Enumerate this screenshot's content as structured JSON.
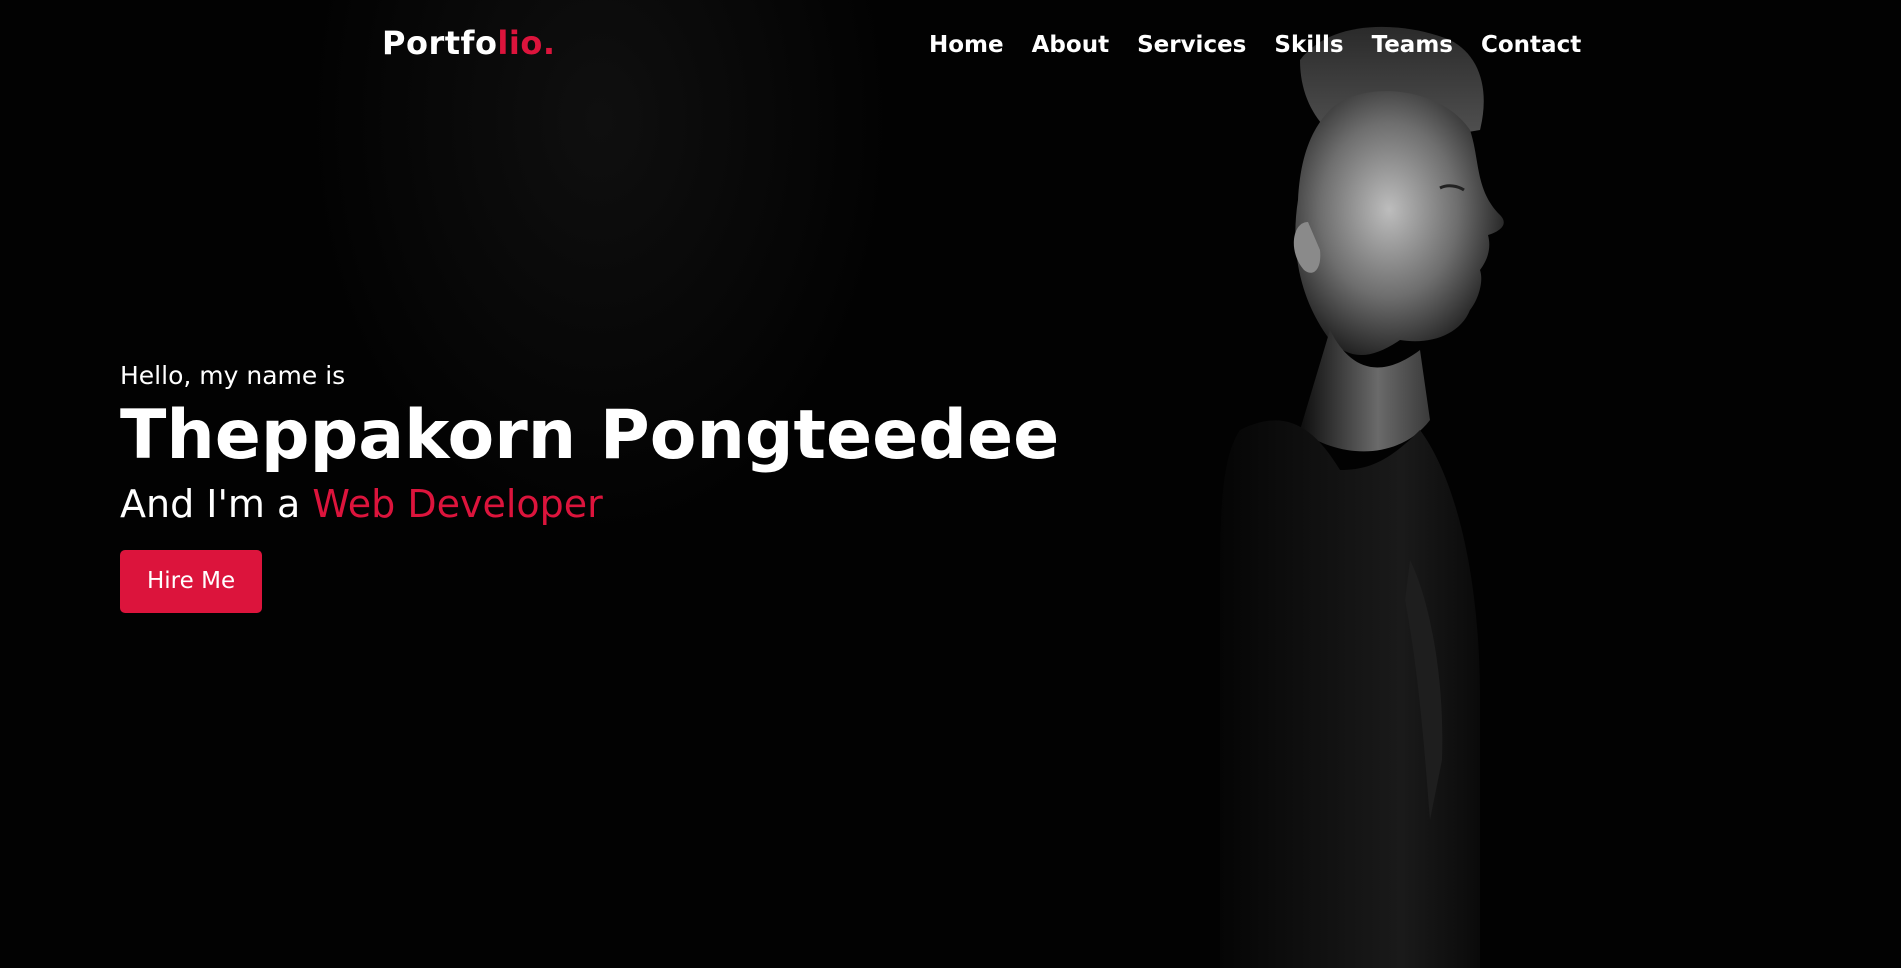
{
  "navbar": {
    "logo_main": "Portfo",
    "logo_accent": "lio.",
    "menu": [
      {
        "label": "Home"
      },
      {
        "label": "About"
      },
      {
        "label": "Services"
      },
      {
        "label": "Skills"
      },
      {
        "label": "Teams"
      },
      {
        "label": "Contact"
      }
    ]
  },
  "hero": {
    "greeting": "Hello, my name is",
    "name": "Theppakorn Pongteedee",
    "role_prefix": "And I'm a ",
    "role_job": "Web Developer",
    "button_label": "Hire Me"
  },
  "colors": {
    "accent": "#dc143c",
    "background": "#000000",
    "text": "#ffffff"
  },
  "images": {
    "hero_background": "man-profile-portrait-photo"
  }
}
